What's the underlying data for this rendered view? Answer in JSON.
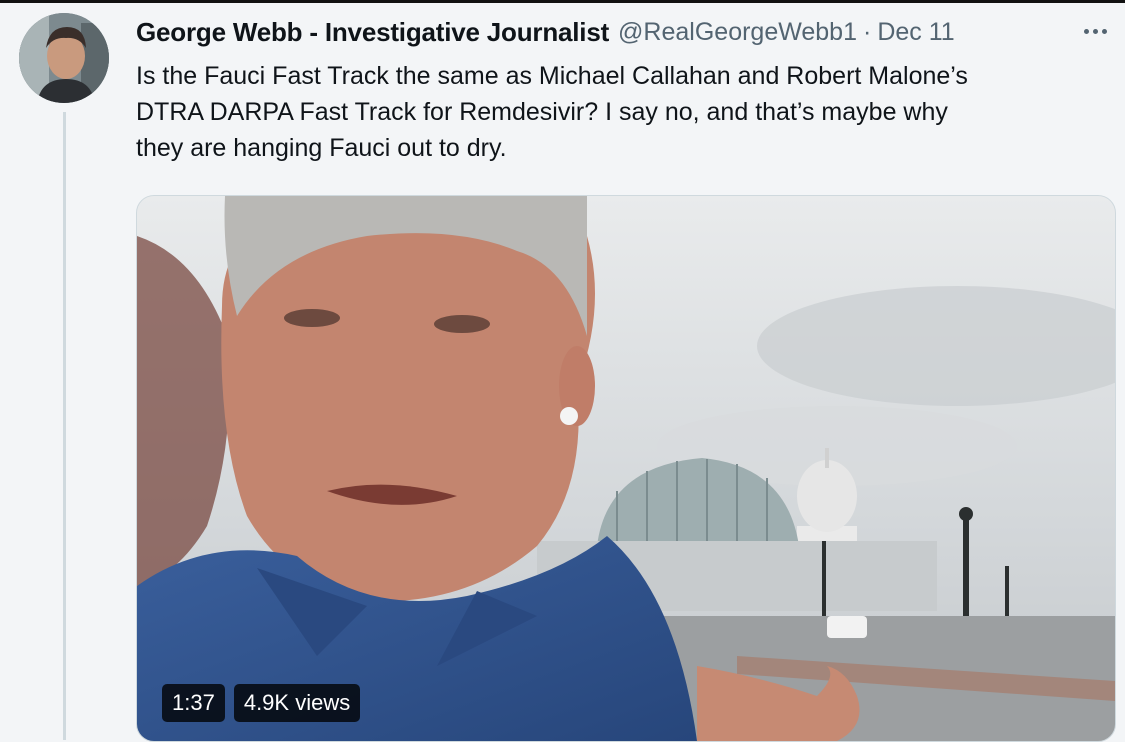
{
  "tweet": {
    "author_name": "George Webb - Investigative Journalist",
    "handle": "@RealGeorgeWebb1",
    "separator": "·",
    "date": "Dec 11",
    "text": "Is the Fauci Fast Track the same as Michael Callahan and Robert Malone’s\nDTRA DARPA Fast Track for Remdesivir?  I say no, and that’s maybe  why\nthey are hanging Fauci out to dry."
  },
  "video": {
    "duration": "1:37",
    "views": "4.9K views"
  },
  "icons": {
    "more": "more-dots-icon",
    "avatar": "profile-avatar"
  }
}
